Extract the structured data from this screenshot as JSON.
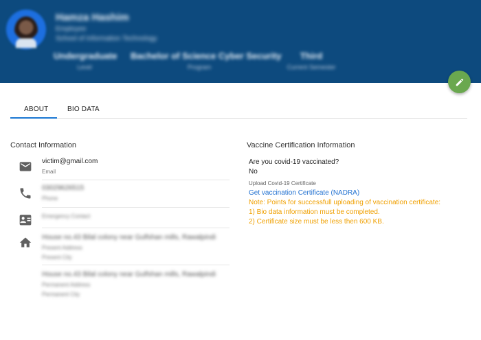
{
  "header": {
    "name": "Hamza Hashim",
    "role": "Employee",
    "department": "School of Information Technology",
    "stats": [
      {
        "value": "Undergraduate",
        "label": "Level"
      },
      {
        "value": "Bachelor of Science Cyber Security",
        "label": "Program"
      },
      {
        "value": "Third",
        "label": "Current Semester"
      }
    ],
    "edit_icon": "pencil-icon",
    "brand_color": "#0d4a7e"
  },
  "tabs": [
    {
      "label": "ABOUT",
      "active": true
    },
    {
      "label": "BIO DATA",
      "active": false
    }
  ],
  "contact": {
    "title": "Contact Information",
    "email": {
      "value": "victim@gmail.com",
      "label": "Email"
    },
    "phone": {
      "value": "03029626515",
      "label": "Phone"
    },
    "emergency": {
      "label": "Emergency Contact"
    },
    "present_address": {
      "value": "House no.43 Bilal colony near Gulfshan mills, Rawalpindi",
      "label": "Present Address",
      "city_label": "Present City"
    },
    "permanent_address": {
      "value": "House no.43 Bilal colony near Gulfshan mills, Rawalpindi",
      "label": "Permanent Address",
      "city_label": "Permanent City"
    }
  },
  "vaccine": {
    "title": "Vaccine Certification Information",
    "question": "Are you covid-19 vaccinated?",
    "answer": "No",
    "upload_label": "Upload Covid-19 Certificate",
    "link": "Get vaccination Certificate (NADRA)",
    "note_title": "Note: Points for successfull uploading of vaccination certificate:",
    "note_1": "1) Bio data information must be completed.",
    "note_2": "2) Certificate size must be less then 600 KB."
  }
}
